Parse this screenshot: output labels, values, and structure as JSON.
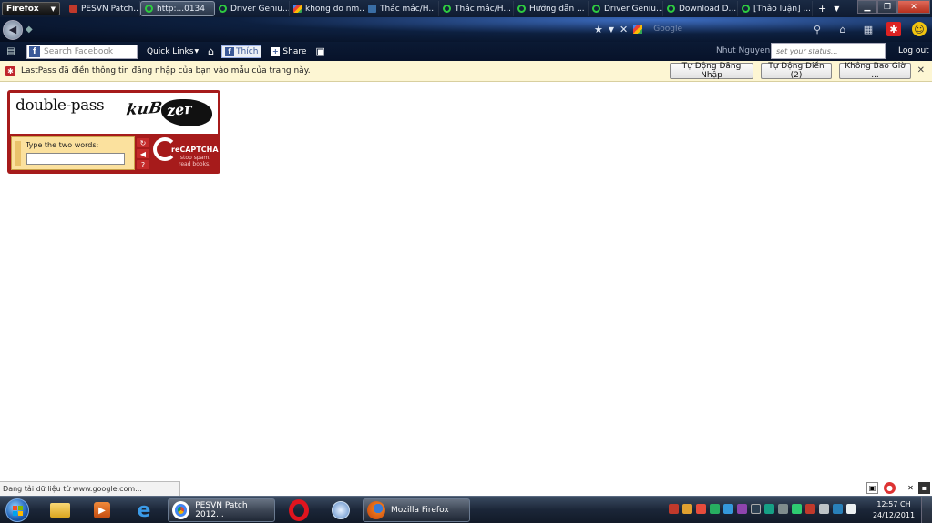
{
  "browser": {
    "menu_label": "Firefox",
    "tabs": [
      {
        "label": "PESVN Patch...",
        "icon": "red-star-icon"
      },
      {
        "label": "http:...0134",
        "icon": "loading-spinner-icon",
        "active": true
      },
      {
        "label": "Driver Geniu...",
        "icon": "loading-spinner-icon"
      },
      {
        "label": "khong do nm...",
        "icon": "google-icon"
      },
      {
        "label": "Thắc mắc/H...",
        "icon": "site-icon"
      },
      {
        "label": "Thắc mắc/H...",
        "icon": "loading-spinner-icon"
      },
      {
        "label": "Hướng dẫn ...",
        "icon": "loading-spinner-icon"
      },
      {
        "label": "Driver Geniu...",
        "icon": "loading-spinner-icon"
      },
      {
        "label": "Download D...",
        "icon": "loading-spinner-icon"
      },
      {
        "label": "[Thảo luận] ...",
        "icon": "loading-spinner-icon"
      }
    ],
    "search_engine_label": "Google"
  },
  "facebook_toolbar": {
    "search_placeholder": "Search Facebook",
    "quick_links": "Quick Links",
    "like_label": "Thích",
    "share_label": "Share",
    "user_name": "Nhut Nguyen",
    "status_placeholder": "set your status...",
    "logout_label": "Log out"
  },
  "lastpass": {
    "message": "LastPass đã điền thông tin đăng nhập của bạn vào mẫu của trang này.",
    "buttons": [
      "Tự Động Đăng Nhập",
      "Tự Động Điền (2)",
      "Không Bao Giờ ..."
    ]
  },
  "captcha": {
    "word1": "double-pass",
    "word2": "kuB",
    "word3": "zer",
    "prompt": "Type the two words:",
    "brand": "reCAPTCHA",
    "tagline_1": "stop spam.",
    "tagline_2": "read books."
  },
  "statusbar": {
    "text": "Đang tải dữ liệu từ www.google.com..."
  },
  "taskbar": {
    "tasks": [
      {
        "label": "PESVN Patch 2012...",
        "icon": "chrome-icon"
      },
      {
        "label": "Mozilla Firefox",
        "icon": "firefox-icon"
      }
    ],
    "clock_time": "12:57 CH",
    "clock_date": "24/12/2011"
  },
  "colors": {
    "captcha_red": "#a61b1b",
    "lastpass_bar": "#fdf6d3",
    "taskbar": "#1b2638"
  }
}
